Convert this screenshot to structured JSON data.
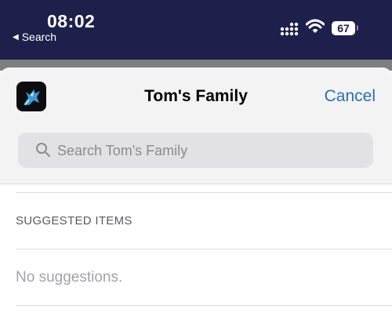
{
  "status_bar": {
    "time": "08:02",
    "back_label": "Search",
    "battery": "67",
    "icons": [
      "signal-icon",
      "wifi-icon",
      "battery-icon"
    ]
  },
  "sheet": {
    "title": "Tom's Family",
    "cancel_label": "Cancel",
    "app_icon": "fox-app-icon",
    "search": {
      "placeholder": "Search Tom's Family",
      "value": ""
    }
  },
  "suggested": {
    "header": "SUGGESTED ITEMS",
    "empty_text": "No suggestions."
  },
  "colors": {
    "status_bar_bg": "#1e1f4b",
    "accent": "#2a6fb0",
    "search_bg": "#e2e2e5"
  }
}
